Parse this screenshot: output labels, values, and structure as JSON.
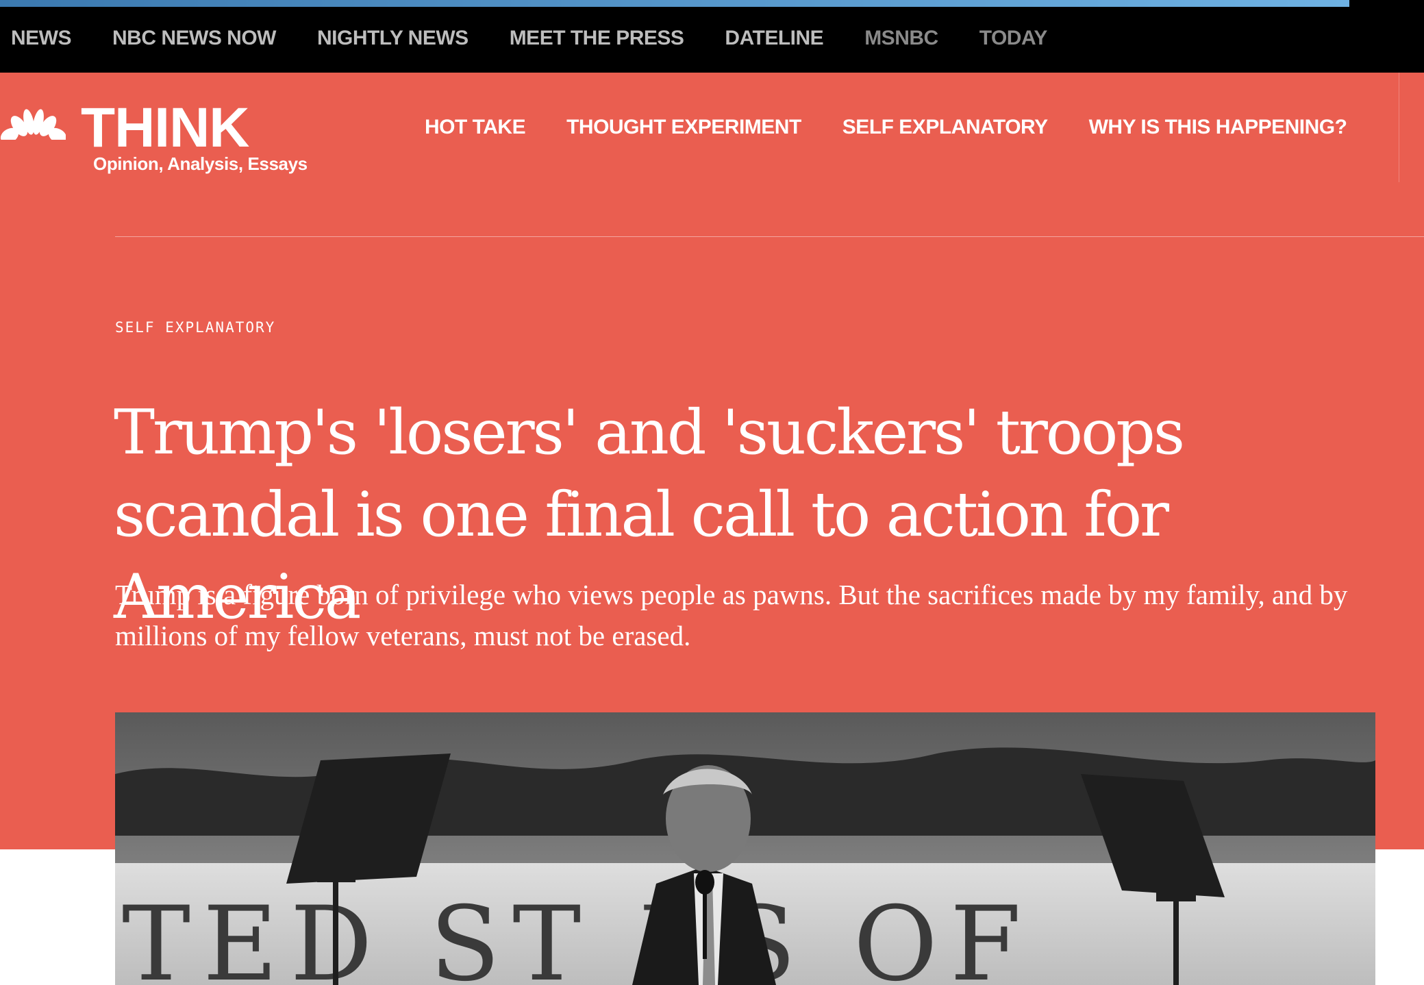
{
  "top_nav": {
    "items": [
      "NEWS",
      "NBC NEWS NOW",
      "NIGHTLY NEWS",
      "MEET THE PRESS",
      "DATELINE",
      "MSNBC",
      "TODAY"
    ]
  },
  "brand": {
    "name": "THINK",
    "tagline": "Opinion, Analysis, Essays",
    "background_color": "#ea5e50"
  },
  "section_nav": {
    "items": [
      "HOT TAKE",
      "THOUGHT EXPERIMENT",
      "SELF EXPLANATORY",
      "WHY IS THIS HAPPENING?"
    ]
  },
  "article": {
    "section": "SELF EXPLANATORY",
    "headline": "Trump's 'losers' and 'suckers' troops scandal is one final call to action for America",
    "dek": "Trump is a figure born of privilege who views people as pawns. But the sacrifices made by my family, and by millions of my fellow veterans, must not be erased.",
    "hero_banner_text": "TED ST ES OF"
  }
}
